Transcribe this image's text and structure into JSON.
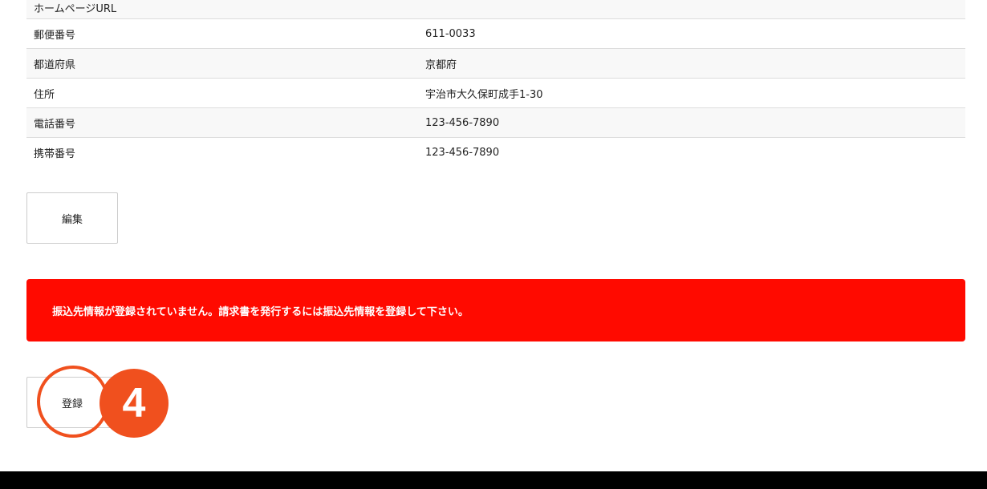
{
  "info_table": {
    "rows": [
      {
        "label": "ホームページURL",
        "value": ""
      },
      {
        "label": "郵便番号",
        "value": "611-0033"
      },
      {
        "label": "都道府県",
        "value": "京都府"
      },
      {
        "label": "住所",
        "value": "宇治市大久保町成手1-30"
      },
      {
        "label": "電話番号",
        "value": "123-456-7890"
      },
      {
        "label": "携帯番号",
        "value": "123-456-7890"
      }
    ]
  },
  "edit_button": {
    "label": "編集"
  },
  "alert": {
    "message": "振込先情報が登録されていません。請求書を発行するには振込先情報を登録して下さい。"
  },
  "register_button": {
    "label": "登録"
  },
  "step_badge": {
    "number": "4"
  },
  "colors": {
    "alert_bg": "#ff0a00",
    "step_accent": "#f0501e"
  }
}
